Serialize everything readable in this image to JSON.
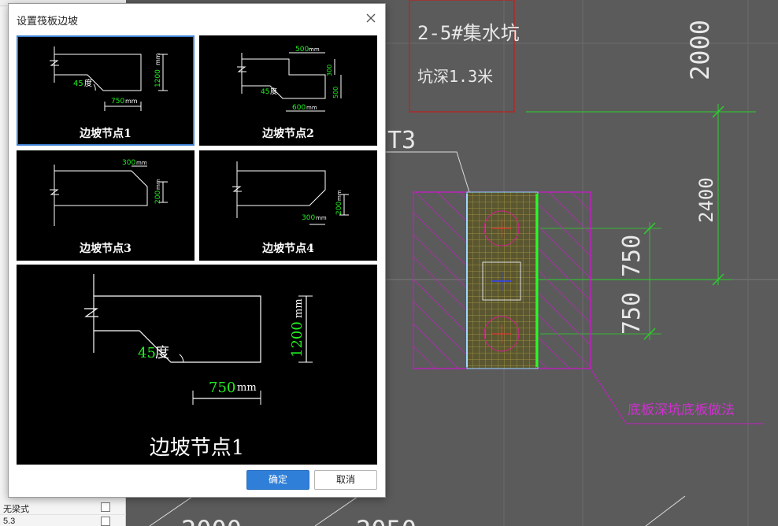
{
  "dialog": {
    "title": "设置筏板边坡",
    "ok_label": "确定",
    "cancel_label": "取消"
  },
  "nodes": [
    {
      "caption": "边坡节点1",
      "angle": "45",
      "angle_unit": "度",
      "width": "750",
      "width_unit": "mm",
      "height": "1200",
      "height_unit": "mm"
    },
    {
      "caption": "边坡节点2",
      "top_width": "500",
      "step": "300",
      "depth": "500",
      "angle": "45",
      "angle_unit": "度",
      "bottom_width": "600",
      "unit": "mm"
    },
    {
      "caption": "边坡节点3",
      "width": "300",
      "height": "200",
      "unit": "mm"
    },
    {
      "caption": "边坡节点4",
      "width": "300",
      "height": "200",
      "unit": "mm"
    }
  ],
  "preview": {
    "caption": "边坡节点1",
    "angle": "45",
    "angle_unit": "度",
    "width": "750",
    "width_unit": "mm",
    "height": "1200",
    "height_unit": "mm"
  },
  "left_panel": {
    "rows": [
      "无梁式",
      "5.3"
    ]
  },
  "cad": {
    "label_pit_name": "2-5#集水坑",
    "label_pit_depth": "坑深1.3米",
    "tag": "T3",
    "dim_2000": "2000",
    "dim_2400": "2400",
    "dim_750_a": "750",
    "dim_750_b": "750",
    "bottom_left": "2000",
    "bottom_right": "2050",
    "magenta_note": "底板深坑底板做法"
  },
  "colors": {
    "accent": "#2f7fd8",
    "dim_green": "#22ee22",
    "cad_bg": "#5b5b5b",
    "magenta": "#c020c0"
  }
}
